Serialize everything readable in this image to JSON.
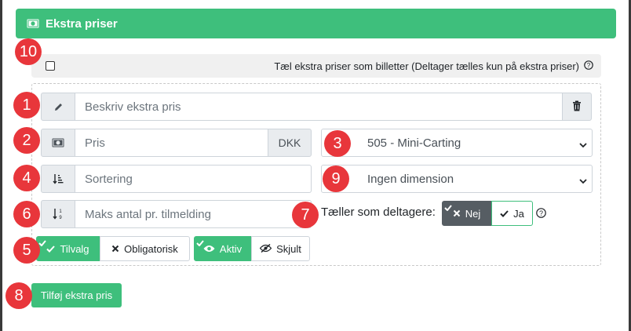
{
  "header": {
    "title": "Ekstra priser",
    "icon": "money-icon"
  },
  "badges": [
    "10",
    "1",
    "2",
    "3",
    "4",
    "9",
    "6",
    "7",
    "5",
    "8"
  ],
  "count_as_tickets": {
    "checked": false,
    "label": "Tæl ekstra priser som billetter (Deltager tælles kun på ekstra priser)"
  },
  "description": {
    "placeholder": "Beskriv ekstra pris",
    "icon": "pencil-icon",
    "delete_icon": "trash-icon"
  },
  "price": {
    "placeholder": "Pris",
    "currency": "DKK",
    "icon": "money-icon"
  },
  "category_select": {
    "value": "505 - Mini-Carting"
  },
  "sort": {
    "placeholder": "Sortering",
    "icon": "sort-icon"
  },
  "dimension_select": {
    "value": "Ingen dimension"
  },
  "max_per_signup": {
    "placeholder": "Maks antal pr. tilmelding",
    "icon": "sort-numeric-icon"
  },
  "counts_as_participants": {
    "label": "Tæller som deltagere:",
    "no": "Nej",
    "yes": "Ja",
    "selected": "Nej"
  },
  "optional_toggle": {
    "optional": "Tilvalg",
    "mandatory": "Obligatorisk",
    "selected": "Tilvalg"
  },
  "visibility_toggle": {
    "active": "Aktiv",
    "hidden": "Skjult",
    "selected": "Aktiv"
  },
  "add_button": {
    "label": "Tilføj ekstra pris"
  },
  "colors": {
    "green": "#3ebf7c",
    "badge_red": "#e8363b",
    "dark": "#565d63"
  }
}
